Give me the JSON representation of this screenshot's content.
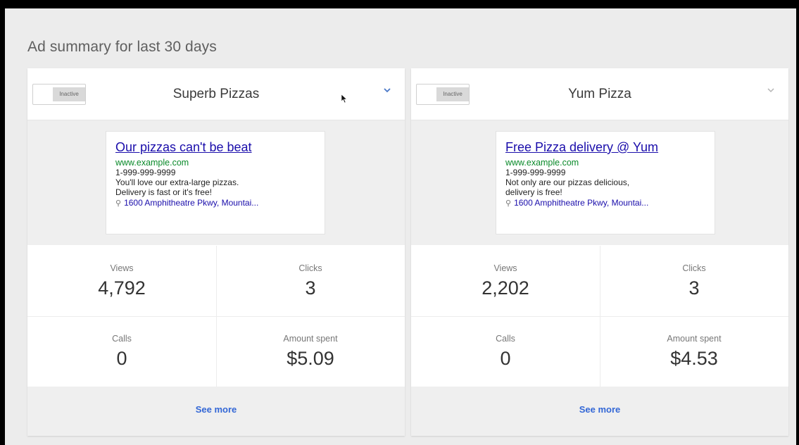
{
  "page": {
    "title": "Ad summary for last 30 days"
  },
  "cards": [
    {
      "toggle_label": "Inactive",
      "name": "Superb Pizzas",
      "ad": {
        "headline": "Our pizzas can't be beat",
        "url": "www.example.com",
        "phone": "1-999-999-9999",
        "line1": "You'll love our extra-large pizzas.",
        "line2": "Delivery is fast or it's free!",
        "location": "1600 Amphitheatre Pkwy, Mountai..."
      },
      "stats": {
        "views_label": "Views",
        "views": "4,792",
        "clicks_label": "Clicks",
        "clicks": "3",
        "calls_label": "Calls",
        "calls": "0",
        "spent_label": "Amount spent",
        "spent": "$5.09"
      },
      "footer_label": "See more"
    },
    {
      "toggle_label": "Inactive",
      "name": "Yum Pizza",
      "ad": {
        "headline": "Free Pizza delivery @ Yum",
        "url": "www.example.com",
        "phone": "1-999-999-9999",
        "line1": "Not only are our pizzas delicious,",
        "line2": "delivery is free!",
        "location": "1600 Amphitheatre Pkwy, Mountai..."
      },
      "stats": {
        "views_label": "Views",
        "views": "2,202",
        "clicks_label": "Clicks",
        "clicks": "3",
        "calls_label": "Calls",
        "calls": "0",
        "spent_label": "Amount spent",
        "spent": "$4.53"
      },
      "footer_label": "See more"
    }
  ],
  "icons": {
    "expand": "chevron-down-icon",
    "location": "map-pin-icon",
    "pointer": "mouse-cursor-icon"
  },
  "colors": {
    "link": "#1a0dab",
    "url": "#0a8a2a",
    "accent": "#3367d6",
    "background": "#ececec"
  }
}
